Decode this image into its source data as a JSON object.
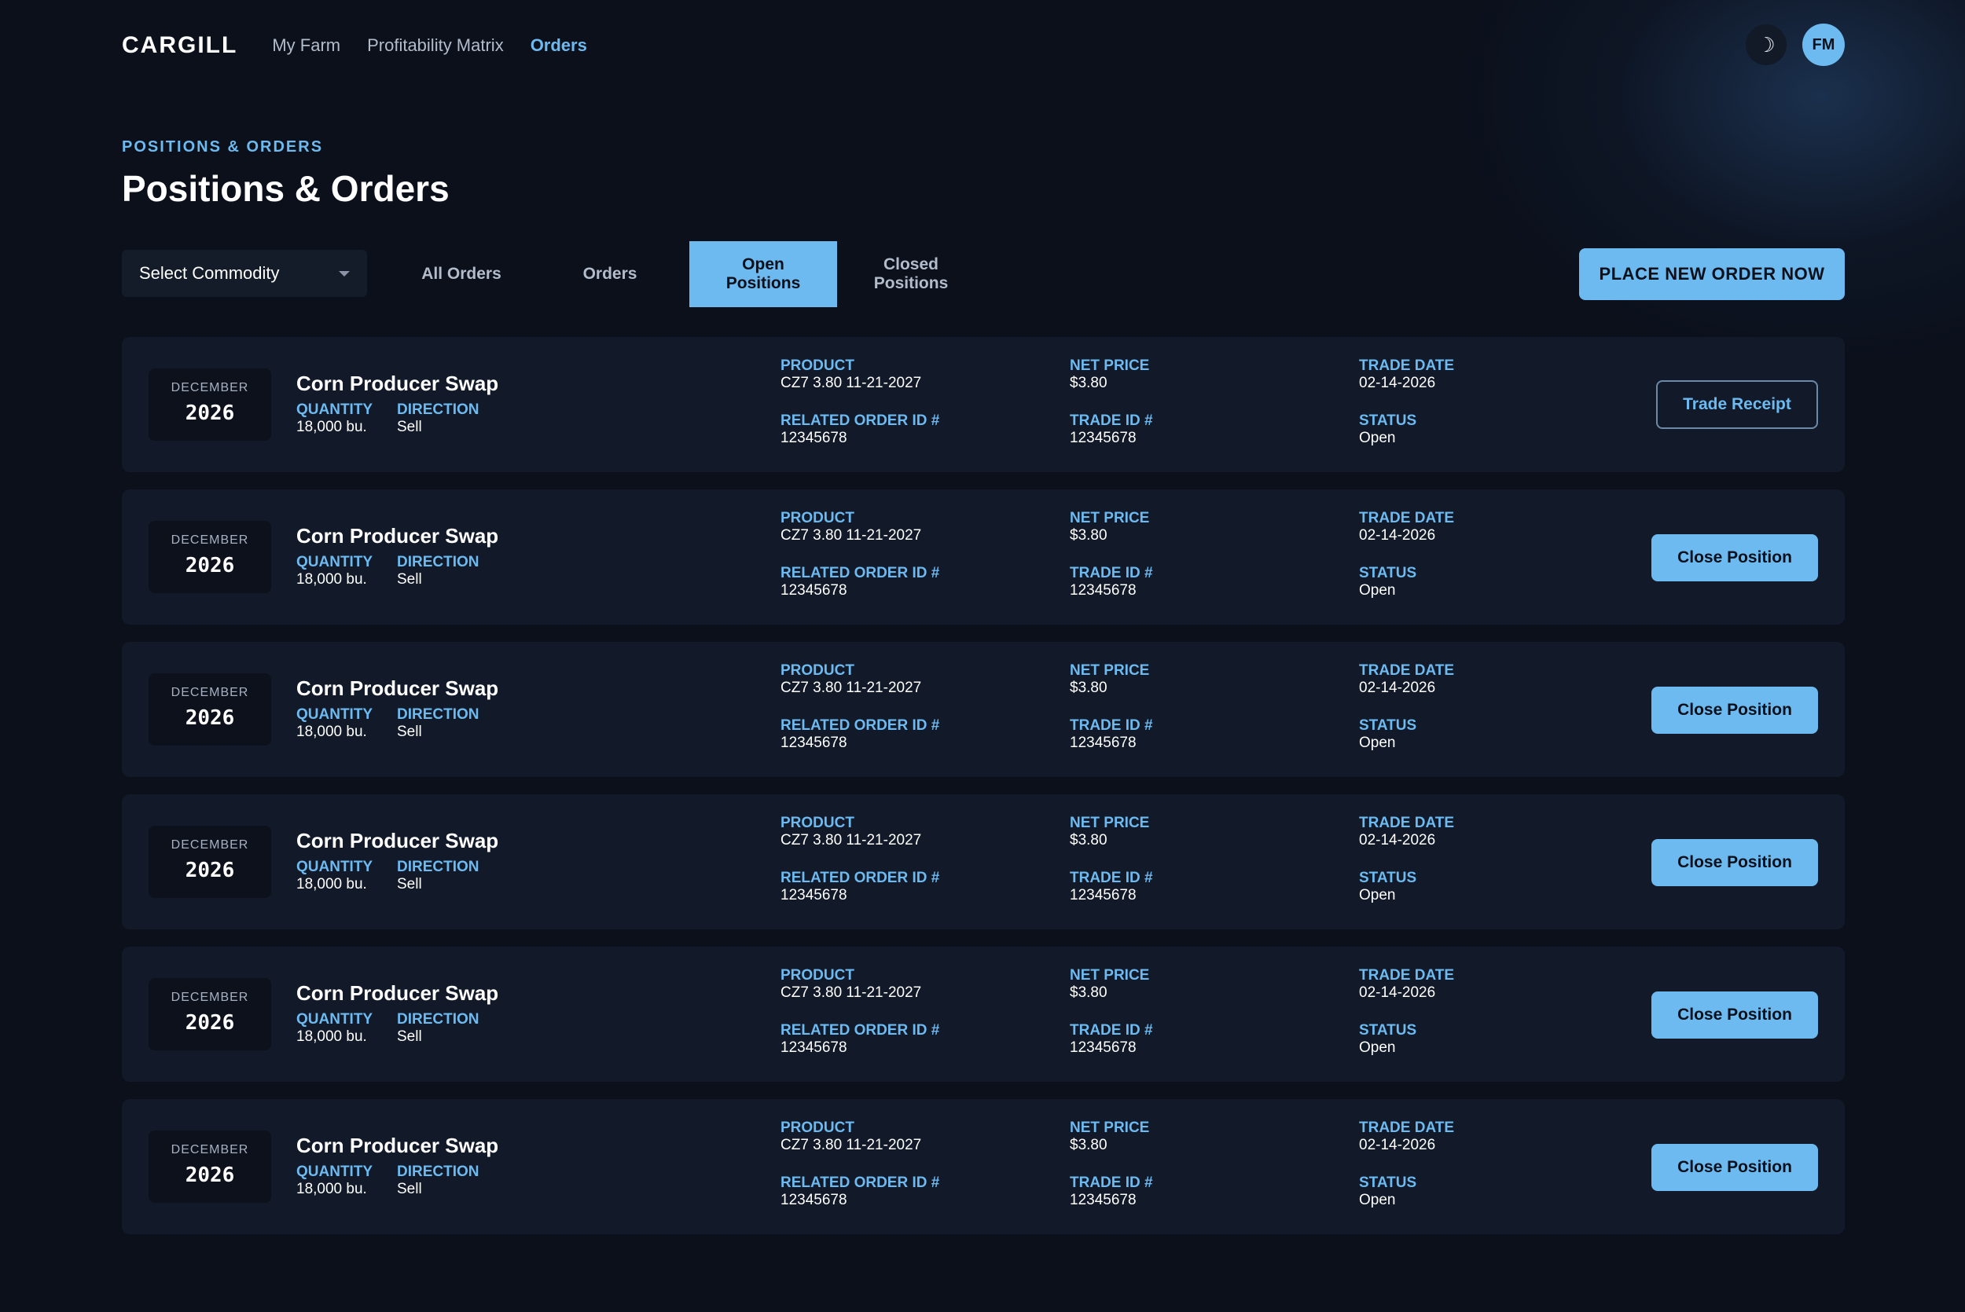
{
  "nav": {
    "logo": "CARGILL",
    "links": [
      "My Farm",
      "Profitability Matrix",
      "Orders"
    ],
    "theme_icon": "moon-icon",
    "avatar_initials": "FM"
  },
  "header": {
    "eyebrow": "POSITIONS & ORDERS",
    "title": "Positions & Orders"
  },
  "toolbar": {
    "select_commodity": "Select Commodity",
    "tabs": [
      "All Orders",
      "Orders",
      "Open\nPositions",
      "Closed\nPositions"
    ],
    "active_tab": "Open Positions",
    "place_order": "PLACE NEW ORDER NOW"
  },
  "labels": {
    "quantity": "QUANTITY",
    "direction": "DIRECTION",
    "product": "PRODUCT",
    "related_order": "RELATED ORDER ID #",
    "net_price": "NET PRICE",
    "trade_id": "TRADE ID #",
    "trade_date": "TRADE DATE",
    "status": "STATUS"
  },
  "positions": [
    {
      "month": "DECEMBER",
      "year": "2026",
      "name": "Corn Producer Swap",
      "quantity": "18,000 bu.",
      "direction": "Sell",
      "product": "CZ7 3.80 11-21-2027",
      "related_order_id": "12345678",
      "net_price": "$3.80",
      "trade_id": "12345678",
      "trade_date": "02-14-2026",
      "status": "Open",
      "action": "Trade Receipt"
    },
    {
      "month": "DECEMBER",
      "year": "2026",
      "name": "Corn Producer Swap",
      "quantity": "18,000 bu.",
      "direction": "Sell",
      "product": "CZ7 3.80 11-21-2027",
      "related_order_id": "12345678",
      "net_price": "$3.80",
      "trade_id": "12345678",
      "trade_date": "02-14-2026",
      "status": "Open",
      "action": "Close Position"
    },
    {
      "month": "DECEMBER",
      "year": "2026",
      "name": "Corn Producer Swap",
      "quantity": "18,000 bu.",
      "direction": "Sell",
      "product": "CZ7 3.80 11-21-2027",
      "related_order_id": "12345678",
      "net_price": "$3.80",
      "trade_id": "12345678",
      "trade_date": "02-14-2026",
      "status": "Open",
      "action": "Close Position"
    },
    {
      "month": "DECEMBER",
      "year": "2026",
      "name": "Corn Producer Swap",
      "quantity": "18,000 bu.",
      "direction": "Sell",
      "product": "CZ7 3.80 11-21-2027",
      "related_order_id": "12345678",
      "net_price": "$3.80",
      "trade_id": "12345678",
      "trade_date": "02-14-2026",
      "status": "Open",
      "action": "Close Position"
    },
    {
      "month": "DECEMBER",
      "year": "2026",
      "name": "Corn Producer Swap",
      "quantity": "18,000 bu.",
      "direction": "Sell",
      "product": "CZ7 3.80 11-21-2027",
      "related_order_id": "12345678",
      "net_price": "$3.80",
      "trade_id": "12345678",
      "trade_date": "02-14-2026",
      "status": "Open",
      "action": "Close Position"
    },
    {
      "month": "DECEMBER",
      "year": "2026",
      "name": "Corn Producer Swap",
      "quantity": "18,000 bu.",
      "direction": "Sell",
      "product": "CZ7 3.80 11-21-2027",
      "related_order_id": "12345678",
      "net_price": "$3.80",
      "trade_id": "12345678",
      "trade_date": "02-14-2026",
      "status": "Open",
      "action": "Close Position"
    }
  ],
  "colors": {
    "background": "#0b101b",
    "card": "#121929",
    "accent": "#6cbaf0",
    "muted_text": "#b2bccb"
  }
}
